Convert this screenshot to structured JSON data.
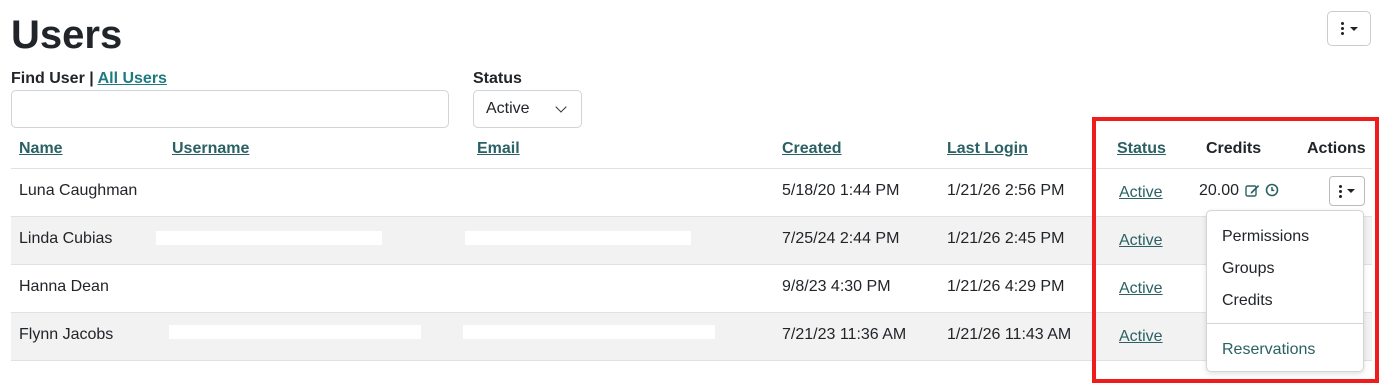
{
  "page": {
    "title": "Users"
  },
  "filters": {
    "find_label": "Find User",
    "separator": " | ",
    "all_users_link": "All Users",
    "search_value": "",
    "status_label": "Status",
    "status_selected": "Active"
  },
  "table": {
    "headers": {
      "name": "Name",
      "username": "Username",
      "email": "Email",
      "created": "Created",
      "last_login": "Last Login",
      "status": "Status",
      "credits": "Credits",
      "actions": "Actions"
    },
    "rows": [
      {
        "name": "Luna Caughman",
        "created": "5/18/20 1:44 PM",
        "last_login": "1/21/26 2:56 PM",
        "status": "Active",
        "credits": "20.00"
      },
      {
        "name": "Linda Cubias",
        "created": "7/25/24 2:44 PM",
        "last_login": "1/21/26 2:45 PM",
        "status": "Active"
      },
      {
        "name": "Hanna Dean",
        "created": "9/8/23 4:30 PM",
        "last_login": "1/21/26 4:29 PM",
        "status": "Active"
      },
      {
        "name": "Flynn Jacobs",
        "created": "7/21/23 11:36 AM",
        "last_login": "1/21/26 11:43 AM",
        "status": "Active"
      }
    ]
  },
  "actions_menu": {
    "items": [
      "Permissions",
      "Groups",
      "Credits"
    ],
    "secondary": "Reservations"
  },
  "icons": {
    "top_menu": "vertical-ellipsis-icon",
    "row_menu": "vertical-ellipsis-icon",
    "credit_edit": "edit-icon",
    "credit_history": "clock-icon"
  },
  "colors": {
    "link": "#2b6164",
    "highlight_border": "#ee1c1c",
    "row_alt_bg": "#f2f2f2"
  }
}
